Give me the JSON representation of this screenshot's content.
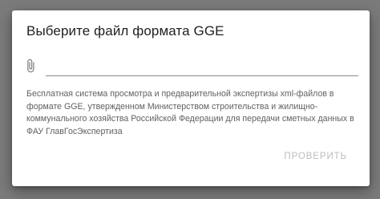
{
  "dialog": {
    "title": "Выберите файл формата GGE",
    "file_input": {
      "value": "",
      "placeholder": "",
      "icon": "paperclip-icon"
    },
    "description": "Бесплатная система просмотра и предварительной экспертизы xml-файлов в формате GGE, утвержденном Министерством строительства и жилищно-коммунального хозяйства Российской Федерации для передачи сметных данных в ФАУ ГлавГосЭкспертиза",
    "check_button": {
      "label": "ПРОВЕРИТЬ",
      "state": "disabled"
    }
  },
  "colors": {
    "backdrop": "#7b7b7b",
    "dialog_bg": "#ffffff",
    "title_text": "#212121",
    "body_text": "#616161",
    "disabled_button_text": "#bdbdbd",
    "input_underline": "#8a8a8a"
  }
}
